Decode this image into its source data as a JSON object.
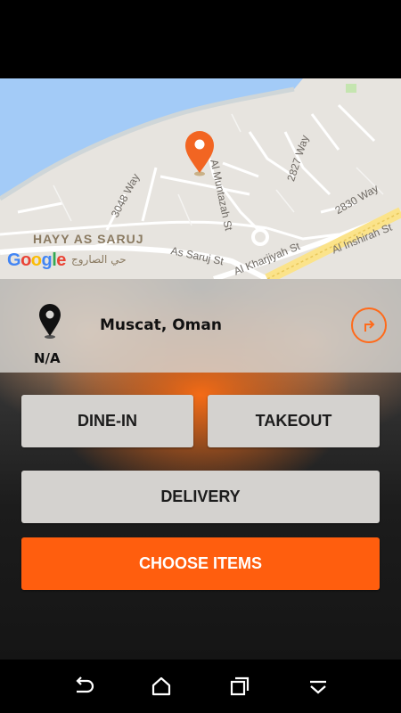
{
  "map": {
    "area_label": "HAYY AS SARUJ",
    "arabic_label": "حي الصاروج",
    "streets": [
      "3048 Way",
      "Al Muntazah St",
      "2827 Way",
      "2830 Way",
      "As Saruj St",
      "Al Kharjiyah St",
      "Al Inshirah St"
    ],
    "logo": [
      "G",
      "o",
      "o",
      "g",
      "l",
      "e"
    ]
  },
  "location": {
    "address": "Muscat, Oman",
    "distance": "N/A"
  },
  "order": {
    "dine_in": "DINE-IN",
    "takeout": "TAKEOUT",
    "delivery": "DELIVERY",
    "choose_items": "CHOOSE ITEMS"
  },
  "colors": {
    "accent": "#ff5e0e",
    "water": "#a3cbf7",
    "marker": "#f26522"
  },
  "icons": {
    "pin": "location-pin-icon",
    "directions": "directions-icon",
    "nav": [
      "back-icon",
      "home-icon",
      "recents-icon",
      "menu-icon"
    ]
  }
}
